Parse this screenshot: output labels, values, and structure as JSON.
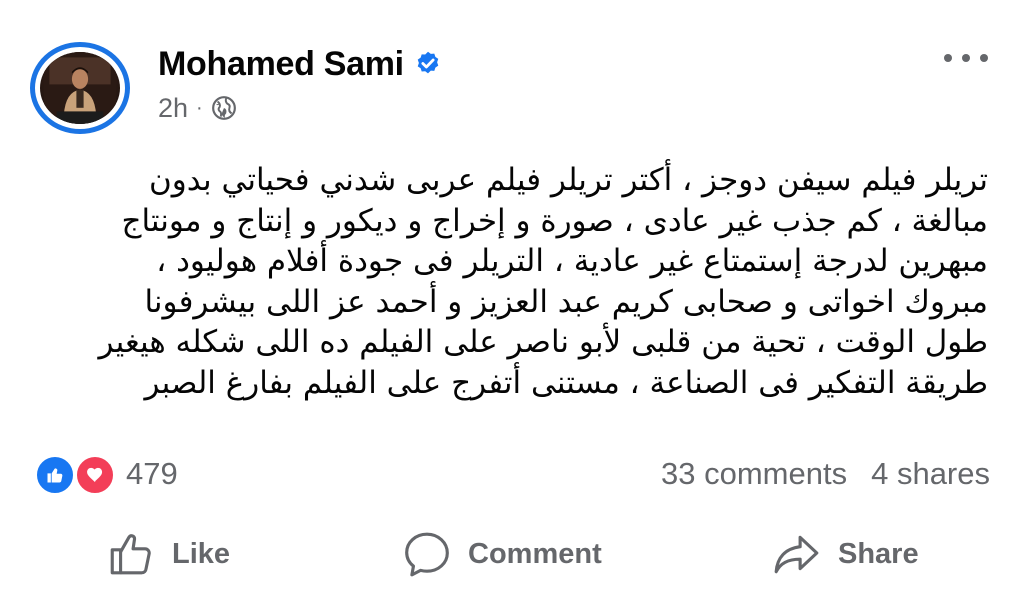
{
  "post": {
    "author": "Mohamed Sami",
    "verified": true,
    "time": "2h",
    "separator": "·",
    "audience_icon": "globe-icon",
    "text_lines": [
      "تريلر فيلم سيفن دوجز ، أكتر تريلر فيلم عربى شدني فحياتي بدون",
      "مبالغة ، كم جذب غير عادى ، صورة و إخراج و ديكور و إنتاج و مونتاج",
      "مبهرين لدرجة إستمتاع غير عادية ، التريلر فى جودة أفلام هوليود ،",
      "مبروك اخواتى و صحابى كريم عبد العزيز و أحمد عز اللى بيشرفونا",
      "طول الوقت ، تحية من قلبى لأبو ناصر على الفيلم ده اللى شكله هيغير",
      "طريقة التفكير فى الصناعة ، مستنى أتفرج على الفيلم بفارغ الصبر"
    ]
  },
  "stats": {
    "reactions_count": "479",
    "comments": "33 comments",
    "shares": "4 shares"
  },
  "actions": {
    "like": "Like",
    "comment": "Comment",
    "share": "Share"
  },
  "colors": {
    "accent": "#1877f2",
    "love": "#f33e58",
    "secondary_text": "#65676b",
    "avatar_ring": "#1b74e4"
  }
}
